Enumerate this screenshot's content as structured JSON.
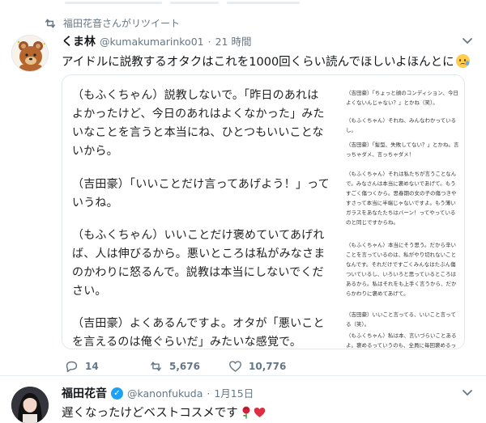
{
  "tweets": [
    {
      "retweeted_by": "福田花音さんがリツイート",
      "display_name": "くま林",
      "handle": "@kumakumarinko01",
      "separator": "·",
      "time": "21 時間",
      "text": "アイドルに説教するオタクはこれを1000回くらい読んでほしいよほんとに",
      "text_emoji": "crying-face-emoji",
      "media": {
        "left_paragraphs": [
          "（もふくちゃん）説教しないで。「昨日のあれはよかったけど、今日のあれはよくなかった」みたいなことを言うと本当にね、ひとつもいいことないから。",
          "（吉田豪）「いいことだけ言ってあげよう！」っていうね。",
          "（もふくちゃん）いいことだけ褒めていてあげれば、人は伸びるから。悪いところは私がみなさまのかわりに怒るんで。説教は本当にしないでください。",
          "（吉田豪）よくあるんですよ。オタが「悪いことを言えるのは俺ぐらいだ」みたいな感覚で。"
        ],
        "right_paragraphs": [
          "（吉田豪）「ちょっと顔のコンディション、今日よくないんじゃない？」とかね（笑）。",
          "（もふくちゃん）それね、みんなわかっているし。",
          "（吉田豪）「髪型、失敗してない？」とかね。言っちゃダメ、言っちゃダメ！",
          "（もふくちゃん）それは私たちが言うことなんで。みなさんは本当に褒めないであげて。もうすごく傷つくから。思春期の女の子の傷つきやすさって本当に半端じゃないですよ。もう薄いガラスをあなたたちはバーン！ってやっているのと同じですからね。",
          "（もふくちゃん）本当にそう思う。だから辛いことを言っているのは、私がやり切れないことなんです。それだけですごくみんなはたぶん傷ついているし、いろいろと思っているところはあるから。私はそれをも上手く言うから、だからかわりに褒めてあげて。",
          "（吉田豪）いいこと言ってる、いいこと言ってる（笑）。",
          "（もふくちゃん）私は本、言いづらいことあるよ。褒めるっていうのも、全員に毎回褒めるって"
        ]
      },
      "actions": {
        "replies": "14",
        "retweets": "5,676",
        "likes": "10,776"
      }
    },
    {
      "display_name": "福田花音",
      "verified_mark": "✓",
      "handle": "@kanonfukuda",
      "separator": "·",
      "time": "1月15日",
      "text": "遅くなったけどベストコスメです",
      "text_emojis": [
        "rose-emoji",
        "red-heart-emoji"
      ]
    }
  ]
}
